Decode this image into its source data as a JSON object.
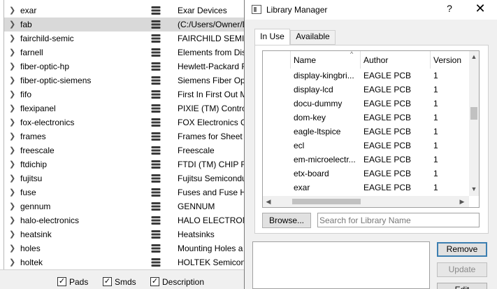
{
  "libraries": [
    {
      "name": "exar",
      "description": "Exar Devices"
    },
    {
      "name": "fab",
      "description": "(C:/Users/Owner/Do",
      "selected": true
    },
    {
      "name": "fairchild-semic",
      "description": "FAIRCHILD SEMICO"
    },
    {
      "name": "farnell",
      "description": "Elements from Dis"
    },
    {
      "name": "fiber-optic-hp",
      "description": "Hewlett-Packard F"
    },
    {
      "name": "fiber-optic-siemens",
      "description": "Siemens Fiber Opt"
    },
    {
      "name": "fifo",
      "description": "First In First Out M"
    },
    {
      "name": "flexipanel",
      "description": "PIXIE (TM) Contro"
    },
    {
      "name": "fox-electronics",
      "description": "FOX Electronics Cr"
    },
    {
      "name": "frames",
      "description": "Frames for Sheet a"
    },
    {
      "name": "freescale",
      "description": "Freescale"
    },
    {
      "name": "ftdichip",
      "description": "FTDI (TM) CHIP Futu"
    },
    {
      "name": "fujitsu",
      "description": "Fujitsu Semicondu"
    },
    {
      "name": "fuse",
      "description": "Fuses and Fuse Ho"
    },
    {
      "name": "gennum",
      "description": "GENNUM"
    },
    {
      "name": "halo-electronics",
      "description": "HALO ELECTRONI"
    },
    {
      "name": "heatsink",
      "description": "Heatsinks"
    },
    {
      "name": "holes",
      "description": "Mounting Holes a"
    },
    {
      "name": "holtek",
      "description": "HOLTEK Semicono"
    }
  ],
  "filters": {
    "pads": {
      "label": "Pads",
      "checked": true
    },
    "smds": {
      "label": "Smds",
      "checked": true
    },
    "description": {
      "label": "Description",
      "checked": true
    }
  },
  "dialog": {
    "title": "Library Manager",
    "help": "?",
    "close": "✕",
    "tabs": [
      "In Use",
      "Available"
    ],
    "active_tab": "In Use",
    "columns": {
      "name": "Name",
      "author": "Author",
      "version": "Version"
    },
    "rows": [
      {
        "name": "display-kingbri...",
        "author": "EAGLE PCB",
        "version": "1"
      },
      {
        "name": "display-lcd",
        "author": "EAGLE PCB",
        "version": "1"
      },
      {
        "name": "docu-dummy",
        "author": "EAGLE PCB",
        "version": "1"
      },
      {
        "name": "dom-key",
        "author": "EAGLE PCB",
        "version": "1"
      },
      {
        "name": "eagle-ltspice",
        "author": "EAGLE PCB",
        "version": "1"
      },
      {
        "name": "ecl",
        "author": "EAGLE PCB",
        "version": "1"
      },
      {
        "name": "em-microelectr...",
        "author": "EAGLE PCB",
        "version": "1"
      },
      {
        "name": "etx-board",
        "author": "EAGLE PCB",
        "version": "1"
      },
      {
        "name": "exar",
        "author": "EAGLE PCB",
        "version": "1"
      }
    ],
    "browse_label": "Browse...",
    "search_placeholder": "Search for Library Name",
    "remove_label": "Remove",
    "update_label": "Update",
    "edit_label": "Edit"
  }
}
